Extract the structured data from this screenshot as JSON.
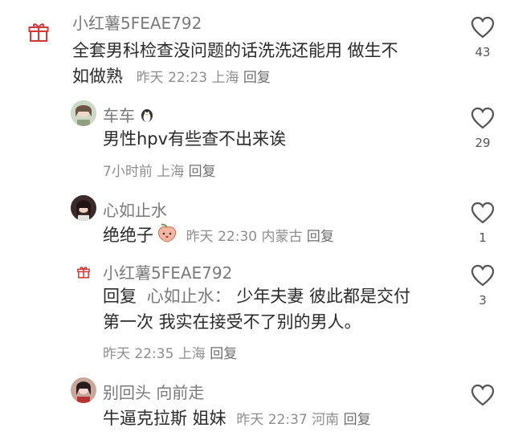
{
  "comments": [
    {
      "username": "小红薯5FEAE792",
      "text": "全套男科检查没问题的话洗洗还能用 做生不如做熟",
      "line1": "全套男科检查没问题的话洗洗还能用 做生不",
      "line2": "如做熟",
      "time": "昨天 22:23",
      "location": "上海",
      "reply_label": "回复",
      "likes": "43",
      "avatar_icon": "gift-icon"
    },
    {
      "username": "车车",
      "username_emoji": "penguin-emoji",
      "text": "男性hpv有些查不出来诶",
      "time": "7小时前",
      "location": "上海",
      "reply_label": "回复",
      "likes": "29",
      "avatar_icon": "user-photo"
    },
    {
      "username": "心如止水",
      "text": "绝绝子",
      "text_emoji": "peach-emoji",
      "time": "昨天 22:30",
      "location": "内蒙古",
      "reply_label": "回复",
      "likes": "1",
      "avatar_icon": "user-photo"
    },
    {
      "username": "小红薯5FEAE792",
      "reply_prefix": "回复",
      "reply_target": "心如止水：",
      "line1": "少年夫妻 彼此都是交付",
      "line2": "第一次 我实在接受不了别的男人。",
      "time": "昨天 22:35",
      "location": "上海",
      "reply_label": "回复",
      "likes": "3",
      "avatar_icon": "gift-icon"
    },
    {
      "username": "别回头 向前走",
      "text": "牛逼克拉斯 姐妹",
      "time": "昨天 22:37",
      "location": "河南",
      "reply_label": "回复",
      "likes": "",
      "avatar_icon": "user-photo"
    }
  ]
}
